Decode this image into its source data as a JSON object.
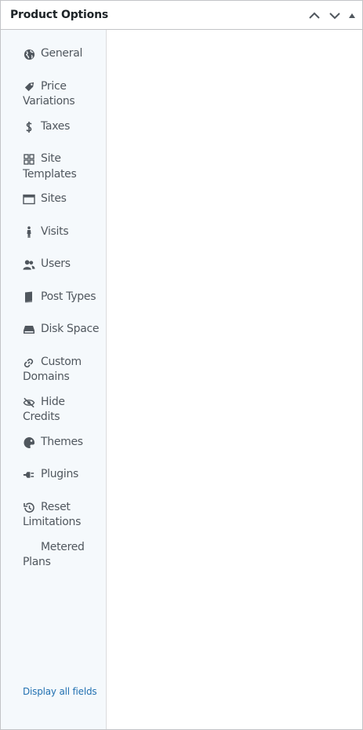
{
  "panel": {
    "title": "Product Options"
  },
  "header_controls": [
    "move-up",
    "move-down",
    "toggle-panel"
  ],
  "sidebar": {
    "items": [
      {
        "label": "General",
        "icon": "globe-icon"
      },
      {
        "label": "Price Variations",
        "icon": "tag-icon"
      },
      {
        "label": "Taxes",
        "icon": "dollar-icon"
      },
      {
        "label": "Site Templates",
        "icon": "grid-icon"
      },
      {
        "label": "Sites",
        "icon": "browser-window-icon"
      },
      {
        "label": "Visits",
        "icon": "walking-person-icon"
      },
      {
        "label": "Users",
        "icon": "users-icon"
      },
      {
        "label": "Post Types",
        "icon": "book-icon"
      },
      {
        "label": "Disk Space",
        "icon": "drive-icon"
      },
      {
        "label": "Custom Domains",
        "icon": "link-icon"
      },
      {
        "label": "Hide Credits",
        "icon": "eye-off-icon"
      },
      {
        "label": "Themes",
        "icon": "palette-icon"
      },
      {
        "label": "Plugins",
        "icon": "plug-icon"
      },
      {
        "label": "Reset Limitations",
        "icon": "history-icon"
      },
      {
        "label": "Metered Plans",
        "icon": "none"
      }
    ],
    "display_all": "Display all fields"
  },
  "colors": {
    "sidebar_bg": "#f5f9fc",
    "label": "#50575e",
    "link": "#2271b1",
    "icon": "#50575e"
  }
}
